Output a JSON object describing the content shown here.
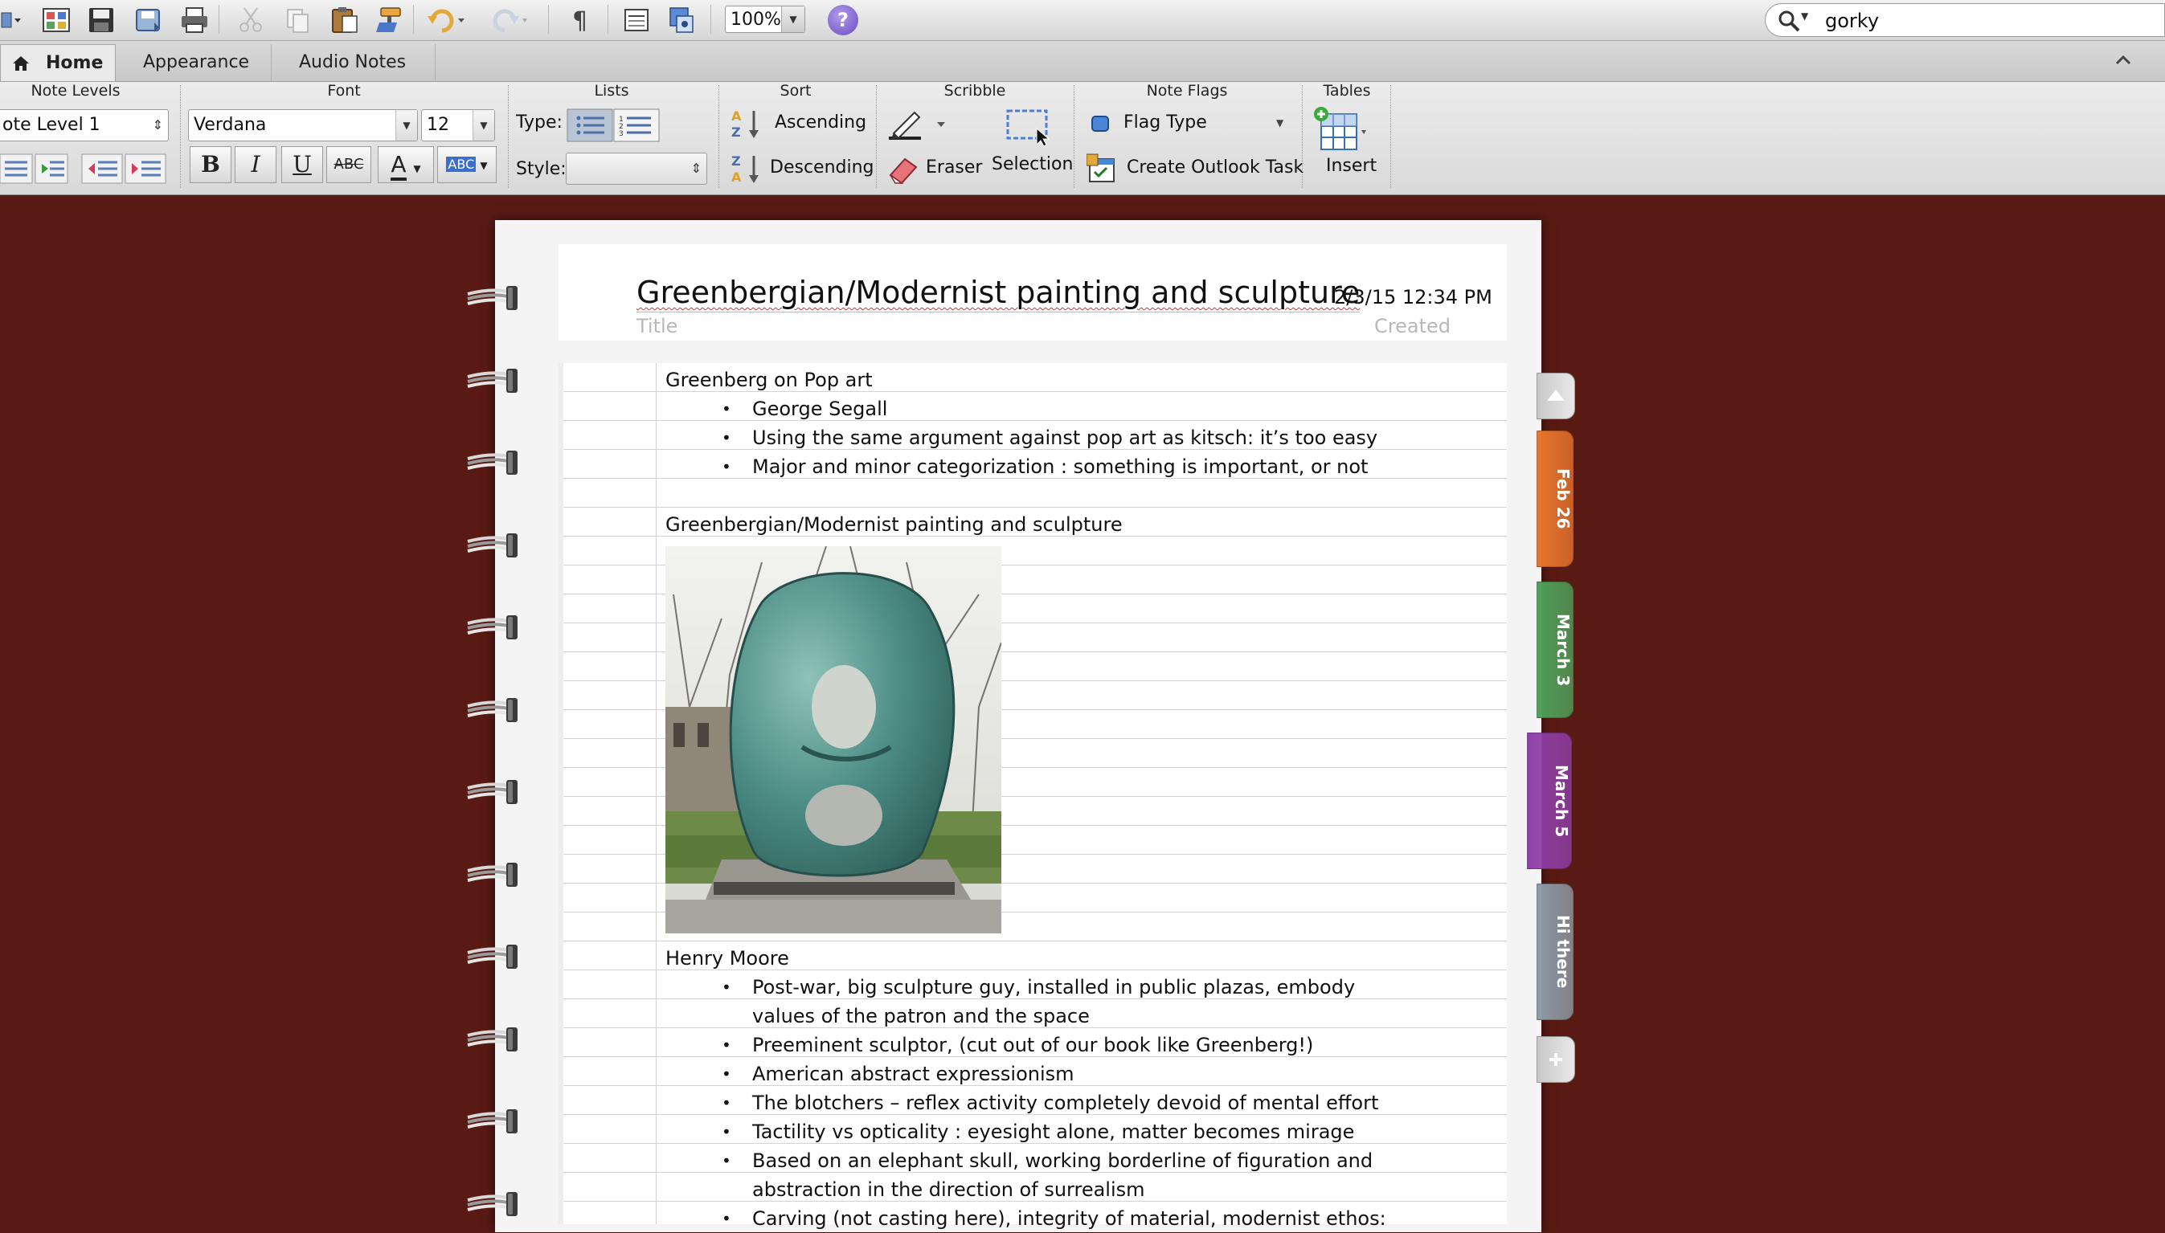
{
  "toolbar": {
    "zoom": "100%",
    "help_label": "?",
    "search": {
      "value": "gorky",
      "placeholder": ""
    },
    "icons": [
      "sidebar-menu-icon",
      "gallery-icon",
      "save-icon",
      "save-as-icon",
      "print-icon",
      "cut-icon",
      "copy-icon",
      "paste-icon",
      "format-painter-icon",
      "undo-icon",
      "redo-icon",
      "pilcrow-icon",
      "page-setup-icon",
      "media-browser-icon"
    ]
  },
  "tabs": [
    {
      "label": "Home",
      "active": true
    },
    {
      "label": "Appearance",
      "active": false
    },
    {
      "label": "Audio Notes",
      "active": false
    }
  ],
  "ribbon": {
    "note_levels": {
      "title": "Note Levels",
      "value": "ote Level 1"
    },
    "font": {
      "title": "Font",
      "family": "Verdana",
      "size": "12",
      "bold": "B",
      "italic": "I",
      "underline": "U",
      "strike": "ABC",
      "color_letter": "A",
      "highlight": "ABC"
    },
    "lists": {
      "title": "Lists",
      "type_label": "Type:",
      "style_label": "Style:",
      "style_value": ""
    },
    "sort": {
      "title": "Sort",
      "ascending": "Ascending",
      "descending": "Descending"
    },
    "scribble": {
      "title": "Scribble",
      "eraser": "Eraser",
      "selection": "Selection"
    },
    "note_flags": {
      "title": "Note Flags",
      "flag_type": "Flag Type",
      "outlook_task": "Create Outlook Task"
    },
    "tables": {
      "title": "Tables",
      "insert": "Insert"
    }
  },
  "note": {
    "title": "Greenbergian/Modernist painting and sculpture",
    "date": "2/3/15 12:34 PM",
    "title_label": "Title",
    "created_label": "Created",
    "pop_art_heading": "Greenberg on Pop art",
    "pop_art_bullets": [
      "George Segall",
      "Using the same argument against pop art as kitsch: it’s too easy",
      "Major and minor categorization : something is important, or not"
    ],
    "section_heading": "Greenbergian/Modernist painting and sculpture",
    "moore_heading": "Henry Moore",
    "moore_bullets": [
      "Post-war, big sculpture guy, installed in public plazas, embody",
      "values of the patron and the space",
      "Preeminent sculptor, (cut out of our book like Greenberg!)",
      "American abstract expressionism",
      "The blotchers – reflex activity completely devoid of mental effort",
      "Tactility vs opticality : eyesight alone, matter becomes mirage",
      "Based on an elephant skull, working borderline of figuration and",
      "abstraction in the direction of surrealism",
      "Carving (not casting here), integrity of material, modernist ethos:"
    ]
  },
  "side_tabs": [
    {
      "label": "Feb 26",
      "color": "#e8742c"
    },
    {
      "label": "March 3",
      "color": "#4fa05a"
    },
    {
      "label": "March 5",
      "color": "#8f3fa8"
    },
    {
      "label": "Hi there",
      "color": "#8e9aa6"
    }
  ]
}
